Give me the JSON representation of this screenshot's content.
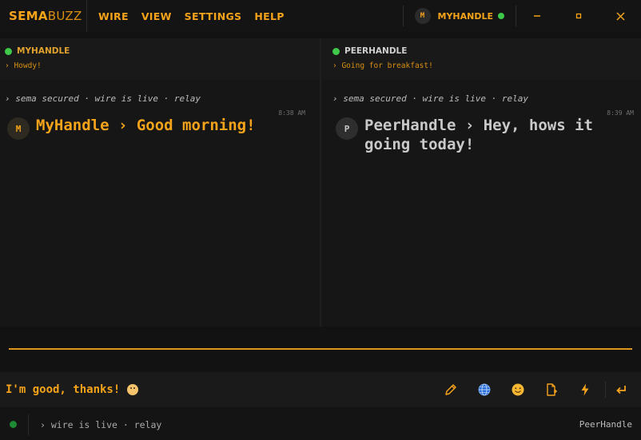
{
  "app": {
    "logo_a": "SEMA",
    "logo_b": "BUZZ",
    "menu": [
      {
        "label": "WIRE"
      },
      {
        "label": "VIEW"
      },
      {
        "label": "SETTINGS"
      },
      {
        "label": "HELP"
      }
    ],
    "account": {
      "initial": "M",
      "name": "MYHANDLE",
      "status_color": "#3ec94a"
    },
    "window_controls": {
      "minimize": "–",
      "maximize": "▫",
      "close": "✕"
    }
  },
  "left_pane": {
    "title": "MYHANDLE",
    "status": "› Howdy!",
    "system": "› sema secured · wire is live · relay",
    "message": {
      "initial": "M",
      "text": "MyHandle › Good morning!",
      "time": "8:38 AM"
    }
  },
  "right_pane": {
    "title": "PEERHANDLE",
    "status": "› Going for breakfast!",
    "system": "› sema secured · wire is live · relay",
    "message": {
      "initial": "P",
      "text": "PeerHandle › Hey, hows it going today!",
      "time": "8:39 AM"
    }
  },
  "composer": {
    "value": "I'm good, thanks!",
    "tools": [
      "pencil-icon",
      "globe-icon",
      "smiley-icon",
      "file-icon",
      "bolt-icon",
      "send-icon"
    ]
  },
  "statusbar": {
    "text": "› wire is live · relay",
    "peer": "PeerHandle",
    "status_color": "#1e8a33"
  },
  "colors": {
    "accent": "#f5a31a",
    "background": "#121212",
    "online": "#3ec94a"
  }
}
